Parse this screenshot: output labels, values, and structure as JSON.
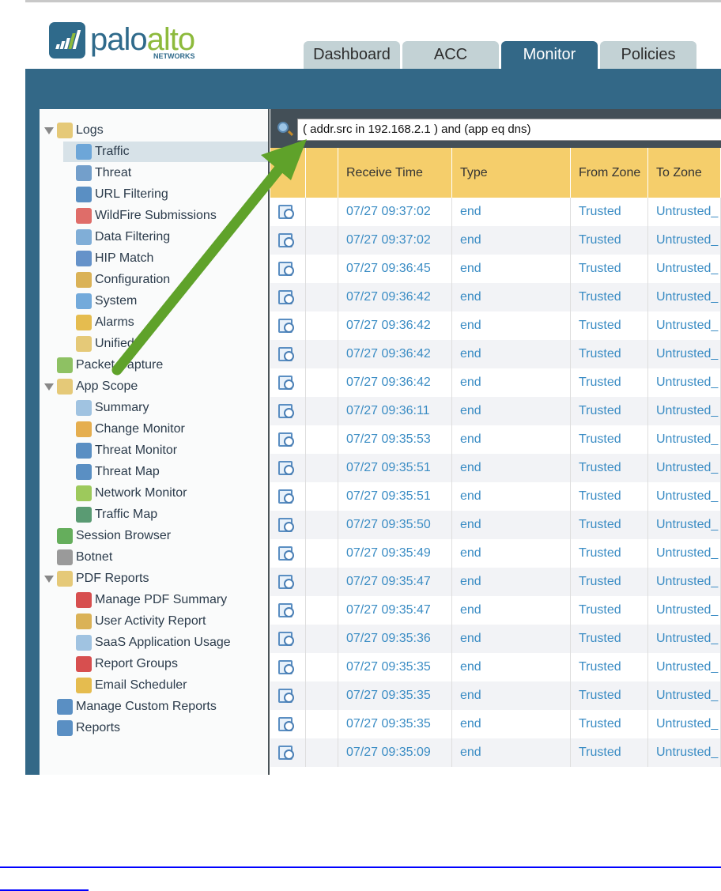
{
  "brand": {
    "name_part1": "palo",
    "name_part2": "alto",
    "sub": "NETWORKS"
  },
  "tabs": [
    {
      "label": "Dashboard",
      "active": false
    },
    {
      "label": "ACC",
      "active": false
    },
    {
      "label": "Monitor",
      "active": true
    },
    {
      "label": "Policies",
      "active": false
    }
  ],
  "sidebar": {
    "items": [
      {
        "label": "Logs",
        "level": 0,
        "expanded": true,
        "icon": "folder-logs-icon",
        "color": "#e0c060"
      },
      {
        "label": "Traffic",
        "level": 1,
        "selected": true,
        "icon": "traffic-log-icon",
        "color": "#5a9bd5"
      },
      {
        "label": "Threat",
        "level": 1,
        "icon": "threat-log-icon",
        "color": "#5a8ec2"
      },
      {
        "label": "URL Filtering",
        "level": 1,
        "icon": "url-filtering-icon",
        "color": "#3d7bb8"
      },
      {
        "label": "WildFire Submissions",
        "level": 1,
        "icon": "wildfire-icon",
        "color": "#d9534f"
      },
      {
        "label": "Data Filtering",
        "level": 1,
        "icon": "data-filtering-icon",
        "color": "#6aa0d0"
      },
      {
        "label": "HIP Match",
        "level": 1,
        "icon": "hip-match-icon",
        "color": "#4a7fc0"
      },
      {
        "label": "Configuration",
        "level": 1,
        "icon": "configuration-icon",
        "color": "#d4a43a"
      },
      {
        "label": "System",
        "level": 1,
        "icon": "system-icon",
        "color": "#5a9bd5"
      },
      {
        "label": "Alarms",
        "level": 1,
        "icon": "alarms-icon",
        "color": "#e0b030"
      },
      {
        "label": "Unified",
        "level": 1,
        "icon": "unified-log-icon",
        "color": "#e0c060"
      },
      {
        "label": "Packet Capture",
        "level": 0,
        "icon": "packet-capture-icon",
        "color": "#7ab648"
      },
      {
        "label": "App Scope",
        "level": 0,
        "expanded": true,
        "icon": "folder-app-scope-icon",
        "color": "#e0c060"
      },
      {
        "label": "Summary",
        "level": 1,
        "icon": "summary-icon",
        "color": "#8fb8dc"
      },
      {
        "label": "Change Monitor",
        "level": 1,
        "icon": "change-monitor-icon",
        "color": "#e0a030"
      },
      {
        "label": "Threat Monitor",
        "level": 1,
        "icon": "threat-monitor-icon",
        "color": "#3d7bb8"
      },
      {
        "label": "Threat Map",
        "level": 1,
        "icon": "threat-map-icon",
        "color": "#3d7bb8"
      },
      {
        "label": "Network Monitor",
        "level": 1,
        "icon": "network-monitor-icon",
        "color": "#8cc040"
      },
      {
        "label": "Traffic Map",
        "level": 1,
        "icon": "traffic-map-icon",
        "color": "#3d8a5a"
      },
      {
        "label": "Session Browser",
        "level": 0,
        "icon": "session-browser-icon",
        "color": "#4aa040"
      },
      {
        "label": "Botnet",
        "level": 0,
        "icon": "botnet-icon",
        "color": "#888888"
      },
      {
        "label": "PDF Reports",
        "level": 0,
        "expanded": true,
        "icon": "folder-pdf-reports-icon",
        "color": "#e0c060"
      },
      {
        "label": "Manage PDF Summary",
        "level": 1,
        "icon": "pdf-summary-icon",
        "color": "#d03030"
      },
      {
        "label": "User Activity Report",
        "level": 1,
        "icon": "user-activity-icon",
        "color": "#d4a43a"
      },
      {
        "label": "SaaS Application Usage",
        "level": 1,
        "icon": "saas-usage-icon",
        "color": "#8fb8dc"
      },
      {
        "label": "Report Groups",
        "level": 1,
        "icon": "report-groups-icon",
        "color": "#d03030"
      },
      {
        "label": "Email Scheduler",
        "level": 1,
        "icon": "email-scheduler-icon",
        "color": "#e0b030"
      },
      {
        "label": "Manage Custom Reports",
        "level": 0,
        "icon": "custom-reports-icon",
        "color": "#3d7bb8"
      },
      {
        "label": "Reports",
        "level": 0,
        "icon": "reports-icon",
        "color": "#3d7bb8"
      }
    ]
  },
  "filter": {
    "value": "( addr.src in 192.168.2.1 ) and (app eq dns)"
  },
  "table": {
    "columns": [
      "",
      "",
      "Receive Time",
      "Type",
      "From Zone",
      "To Zone"
    ],
    "rows": [
      [
        "07/27 09:37:02",
        "end",
        "Trusted",
        "Untrusted_"
      ],
      [
        "07/27 09:37:02",
        "end",
        "Trusted",
        "Untrusted_"
      ],
      [
        "07/27 09:36:45",
        "end",
        "Trusted",
        "Untrusted_"
      ],
      [
        "07/27 09:36:42",
        "end",
        "Trusted",
        "Untrusted_"
      ],
      [
        "07/27 09:36:42",
        "end",
        "Trusted",
        "Untrusted_"
      ],
      [
        "07/27 09:36:42",
        "end",
        "Trusted",
        "Untrusted_"
      ],
      [
        "07/27 09:36:42",
        "end",
        "Trusted",
        "Untrusted_"
      ],
      [
        "07/27 09:36:11",
        "end",
        "Trusted",
        "Untrusted_"
      ],
      [
        "07/27 09:35:53",
        "end",
        "Trusted",
        "Untrusted_"
      ],
      [
        "07/27 09:35:51",
        "end",
        "Trusted",
        "Untrusted_"
      ],
      [
        "07/27 09:35:51",
        "end",
        "Trusted",
        "Untrusted_"
      ],
      [
        "07/27 09:35:50",
        "end",
        "Trusted",
        "Untrusted_"
      ],
      [
        "07/27 09:35:49",
        "end",
        "Trusted",
        "Untrusted_"
      ],
      [
        "07/27 09:35:47",
        "end",
        "Trusted",
        "Untrusted_"
      ],
      [
        "07/27 09:35:47",
        "end",
        "Trusted",
        "Untrusted_"
      ],
      [
        "07/27 09:35:36",
        "end",
        "Trusted",
        "Untrusted_"
      ],
      [
        "07/27 09:35:35",
        "end",
        "Trusted",
        "Untrusted_"
      ],
      [
        "07/27 09:35:35",
        "end",
        "Trusted",
        "Untrusted_"
      ],
      [
        "07/27 09:35:35",
        "end",
        "Trusted",
        "Untrusted_"
      ],
      [
        "07/27 09:35:09",
        "end",
        "Trusted",
        "Untrusted_"
      ]
    ]
  },
  "colors": {
    "brand_blue": "#336887",
    "brand_green": "#8dba3c",
    "header_yellow": "#f5ce6b",
    "link_blue": "#3a8cc4",
    "annotation_arrow": "#5fa22a"
  }
}
